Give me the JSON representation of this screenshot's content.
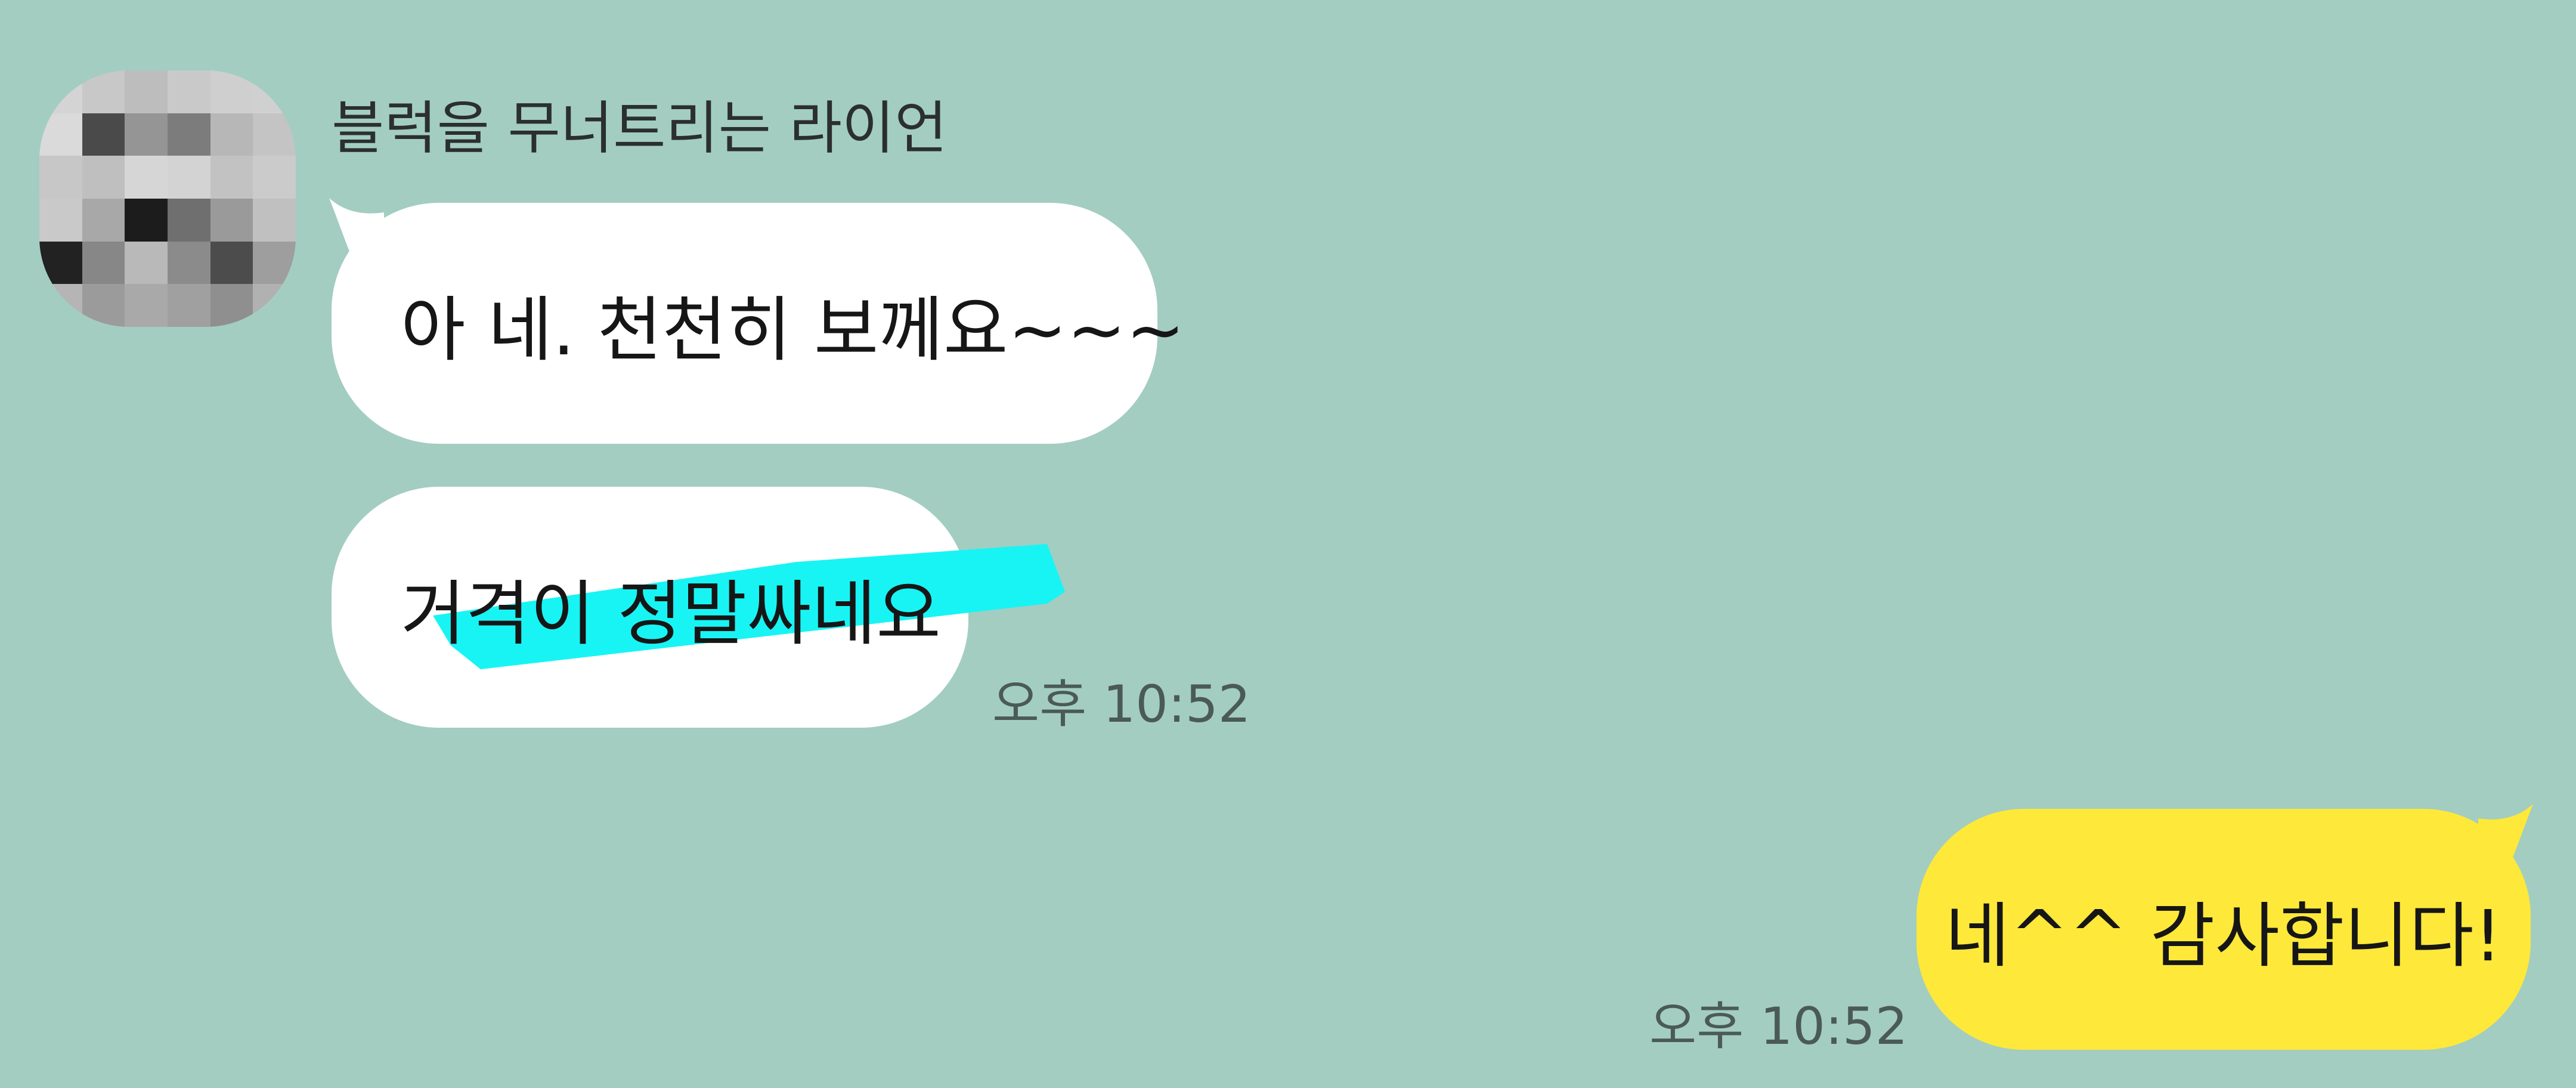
{
  "chat": {
    "sender_name": "블럭을 무너트리는 라이언",
    "avatar_label": "",
    "messages": [
      {
        "text": "아 네.  천천히 보께요~~~"
      },
      {
        "text": "거격이 정말싸네요",
        "time": "오후 10:52"
      }
    ],
    "my_messages": [
      {
        "text": "네^^ 감사합니다!",
        "time": "오후 10:52"
      }
    ]
  },
  "colors": {
    "background": "#a3cdc1",
    "their_bubble": "#ffffff",
    "my_bubble": "#fee83a",
    "highlight": "#18f4f4"
  }
}
